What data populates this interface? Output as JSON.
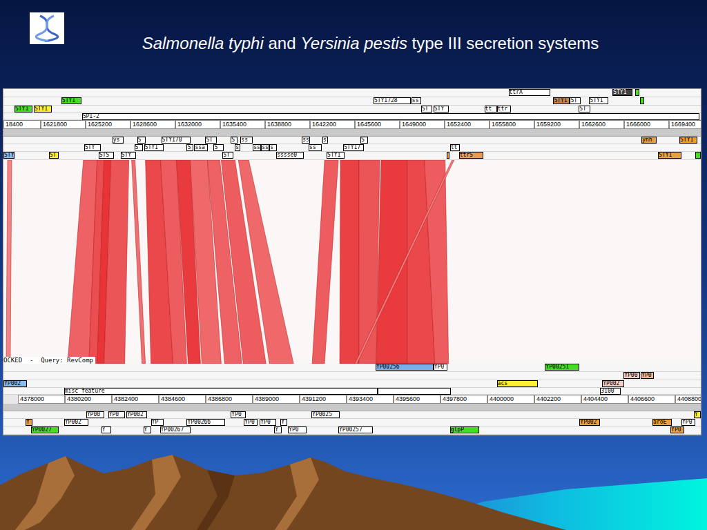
{
  "slide": {
    "title": [
      {
        "text": "Salmonella typhi",
        "italic": true
      },
      {
        "text": " and ",
        "italic": false
      },
      {
        "text": "Yersinia pestis",
        "italic": true
      },
      {
        "text": " type III secretion systems",
        "italic": false
      }
    ]
  },
  "query": {
    "view": {
      "start": 1618976,
      "end": 1671904
    },
    "ticks": [
      "18400",
      "1621800",
      "1625200",
      "1628600",
      "1632000",
      "1635400",
      "1638800",
      "1642200",
      "1645600",
      "1649000",
      "1652400",
      "1655800",
      "1659200",
      "1662600",
      "1666000",
      "1669400"
    ],
    "rows_above": [
      [
        {
          "label": "ttrA",
          "start": 1657312,
          "end": 1660502,
          "color": "#ffffff"
        },
        {
          "label": "STY1",
          "start": 1665209,
          "end": 1666726,
          "color": "#404040"
        },
        {
          "label": "",
          "start": 1666935,
          "end": 1667249,
          "color": "#44dd22"
        }
      ],
      [
        {
          "label": "STY1",
          "start": 1623369,
          "end": 1624886,
          "color": "#44dd22"
        },
        {
          "label": "STY1728",
          "start": 1647061,
          "end": 1649885,
          "color": "#ffffff"
        },
        {
          "label": "ss",
          "start": 1649937,
          "end": 1650670,
          "color": "#ffffff"
        },
        {
          "label": "STY1",
          "start": 1660711,
          "end": 1661967,
          "color": "#c8844c"
        },
        {
          "label": "ST",
          "start": 1661967,
          "end": 1662803,
          "color": "#ffffff"
        },
        {
          "label": "STY1",
          "start": 1663431,
          "end": 1664895,
          "color": "#ffffff"
        },
        {
          "label": "",
          "start": 1667301,
          "end": 1667615,
          "color": "#44dd22"
        }
      ],
      [
        {
          "label": "STY1",
          "start": 1619813,
          "end": 1621173,
          "color": "#44dd22"
        },
        {
          "label": "STY1",
          "start": 1621277,
          "end": 1622637,
          "color": "#ffee33"
        },
        {
          "label": "ST",
          "start": 1650670,
          "end": 1651507,
          "color": "#ffffff"
        },
        {
          "label": "STY",
          "start": 1651611,
          "end": 1652762,
          "color": "#ffffff"
        },
        {
          "label": "tt",
          "start": 1655481,
          "end": 1656423,
          "color": "#ffffff"
        },
        {
          "label": "ttr",
          "start": 1656423,
          "end": 1657469,
          "color": "#ffffff"
        },
        {
          "label": "ST",
          "start": 1662647,
          "end": 1663536,
          "color": "#ffffff"
        }
      ],
      [
        {
          "label": "SPI-2",
          "start": 1624938,
          "end": 1671799,
          "color": "#ffffff"
        }
      ]
    ],
    "rows_below": [
      [
        {
          "label": "ys",
          "start": 1627239,
          "end": 1628076,
          "color": "#ffffff"
        },
        {
          "label": "S",
          "start": 1629122,
          "end": 1629750,
          "color": "#ffffff"
        },
        {
          "label": "STY170",
          "start": 1630953,
          "end": 1633202,
          "color": "#ffffff"
        },
        {
          "label": "ST",
          "start": 1634300,
          "end": 1635189,
          "color": "#ffffff"
        },
        {
          "label": "S",
          "start": 1636235,
          "end": 1636758,
          "color": "#ffffff"
        },
        {
          "label": "ss",
          "start": 1636967,
          "end": 1637909,
          "color": "#ffffff"
        },
        {
          "label": "ss",
          "start": 1641622,
          "end": 1642197,
          "color": "#ffffff"
        },
        {
          "label": "s",
          "start": 1643191,
          "end": 1643609,
          "color": "#ffffff"
        },
        {
          "label": "S",
          "start": 1646067,
          "end": 1646643,
          "color": "#ffffff"
        },
        {
          "label": "ynh",
          "start": 1667406,
          "end": 1668556,
          "color": "#e8a040"
        },
        {
          "label": "STY1",
          "start": 1670282,
          "end": 1671642,
          "color": "#f0a020"
        }
      ],
      [
        {
          "label": "STY",
          "start": 1625095,
          "end": 1626350,
          "color": "#ffffff"
        },
        {
          "label": "S",
          "start": 1628913,
          "end": 1629541,
          "color": "#ffffff"
        },
        {
          "label": "STY1",
          "start": 1629645,
          "end": 1631110,
          "color": "#ffffff"
        },
        {
          "label": "S",
          "start": 1632888,
          "end": 1633411,
          "color": "#ffffff"
        },
        {
          "label": "ssa",
          "start": 1633463,
          "end": 1634509,
          "color": "#ffffff"
        },
        {
          "label": "S",
          "start": 1634928,
          "end": 1635712,
          "color": "#ffffff"
        },
        {
          "label": "s",
          "start": 1636549,
          "end": 1636967,
          "color": "#ffffff"
        },
        {
          "label": "ss",
          "start": 1637909,
          "end": 1638536,
          "color": "#ffffff"
        },
        {
          "label": "ss",
          "start": 1638536,
          "end": 1639164,
          "color": "#ffffff"
        },
        {
          "label": "s",
          "start": 1639164,
          "end": 1639739,
          "color": "#ffffff"
        },
        {
          "label": "ss",
          "start": 1642145,
          "end": 1643139,
          "color": "#ffffff"
        },
        {
          "label": "STY17",
          "start": 1644760,
          "end": 1646329,
          "color": "#ffffff"
        },
        {
          "label": "tt",
          "start": 1652866,
          "end": 1653599,
          "color": "#ffffff"
        }
      ],
      [
        {
          "label": "STY",
          "start": 1618976,
          "end": 1619708,
          "color": "#88bbee"
        },
        {
          "label": "ST",
          "start": 1622428,
          "end": 1623160,
          "color": "#ffee33"
        },
        {
          "label": "STS",
          "start": 1626193,
          "end": 1627344,
          "color": "#ffffff"
        },
        {
          "label": "STY",
          "start": 1627867,
          "end": 1629018,
          "color": "#ffffff"
        },
        {
          "label": "ST",
          "start": 1635607,
          "end": 1636444,
          "color": "#ffffff"
        },
        {
          "label": "sssse0",
          "start": 1639687,
          "end": 1641779,
          "color": "#ffffff"
        },
        {
          "label": "STY1",
          "start": 1643505,
          "end": 1644865,
          "color": "#ffffff"
        },
        {
          "label": "",
          "start": 1652605,
          "end": 1652814,
          "color": "#f0a020"
        },
        {
          "label": "ttrS",
          "start": 1653546,
          "end": 1655377,
          "color": "#e89a58"
        },
        {
          "label": "STY1",
          "start": 1668661,
          "end": 1670439,
          "color": "#e8a040"
        },
        {
          "label": "",
          "start": 1671485,
          "end": 1671904,
          "color": "#44dd22"
        }
      ]
    ]
  },
  "subject": {
    "view": {
      "start": 4377321,
      "end": 4410059
    },
    "ticks": [
      "4378000",
      "4380200",
      "4382400",
      "4384600",
      "4386800",
      "4389000",
      "4391200",
      "4393400",
      "4395600",
      "4397800",
      "4400000",
      "4402200",
      "4404400",
      "4406600",
      "4408800"
    ],
    "rows_above": [
      [
        {
          "label": "YP00256",
          "start": 4394790,
          "end": 4397507,
          "color": "#7ab0e8"
        },
        {
          "label": "YP0",
          "start": 4397507,
          "end": 4398154,
          "color": "#ffffff"
        },
        {
          "label": "YP00251",
          "start": 4402748,
          "end": 4404365,
          "color": "#44dd22"
        }
      ],
      [
        {
          "label": "YP00",
          "start": 4406436,
          "end": 4407212,
          "color": "#f4d0c8"
        },
        {
          "label": "YP0",
          "start": 4407244,
          "end": 4407859,
          "color": "#f0b890"
        }
      ],
      [
        {
          "label": "YP002",
          "start": 4377321,
          "end": 4378421,
          "color": "#88bbee"
        },
        {
          "label": "acs",
          "start": 4400483,
          "end": 4402424,
          "color": "#ffee33"
        },
        {
          "label": "YP002",
          "start": 4405433,
          "end": 4406468,
          "color": "#f4d0c8"
        }
      ],
      [
        {
          "label": "misc feature",
          "start": 4380167,
          "end": 4394887,
          "color": "#ffffff"
        },
        {
          "label": "",
          "start": 4394887,
          "end": 4398316,
          "color": "#ffffff"
        },
        {
          "label": "3100",
          "start": 4405336,
          "end": 4406306,
          "color": "#ffffff"
        }
      ]
    ],
    "rows_below": [
      [
        {
          "label": "YP00",
          "start": 4381203,
          "end": 4382044,
          "color": "#ffffff"
        },
        {
          "label": "YP0",
          "start": 4382238,
          "end": 4383014,
          "color": "#ffffff"
        },
        {
          "label": "YP002",
          "start": 4383079,
          "end": 4384049,
          "color": "#ffffff"
        },
        {
          "label": "YP0",
          "start": 4387996,
          "end": 4388708,
          "color": "#ffffff"
        },
        {
          "label": "YP0025",
          "start": 4391781,
          "end": 4393107,
          "color": "#ffffff"
        },
        {
          "label": "Y",
          "start": 4409735,
          "end": 4410059,
          "color": "#ffee33"
        }
      ],
      [
        {
          "label": "Y",
          "start": 4378356,
          "end": 4378679,
          "color": "#e8a040"
        },
        {
          "label": "YP002",
          "start": 4380167,
          "end": 4381300,
          "color": "#ffffff"
        },
        {
          "label": "YP",
          "start": 4384244,
          "end": 4384826,
          "color": "#ffffff"
        },
        {
          "label": "YP00266",
          "start": 4385926,
          "end": 4387737,
          "color": "#ffffff"
        },
        {
          "label": "YP0",
          "start": 4388611,
          "end": 4389258,
          "color": "#ffffff"
        },
        {
          "label": "YP0",
          "start": 4389355,
          "end": 4390131,
          "color": "#ffffff"
        },
        {
          "label": "Y",
          "start": 4390325,
          "end": 4390649,
          "color": "#ffffff"
        },
        {
          "label": "YP002",
          "start": 4404365,
          "end": 4405336,
          "color": "#e8a040"
        },
        {
          "label": "aroE",
          "start": 4407794,
          "end": 4408700,
          "color": "#e8a040"
        },
        {
          "label": "YP0",
          "start": 4409153,
          "end": 4409800,
          "color": "#ffffff"
        }
      ],
      [
        {
          "label": "YP0027",
          "start": 4378615,
          "end": 4379909,
          "color": "#44dd22"
        },
        {
          "label": "Y",
          "start": 4381914,
          "end": 4382367,
          "color": "#ffffff"
        },
        {
          "label": "Y",
          "start": 4383888,
          "end": 4384244,
          "color": "#ffffff"
        },
        {
          "label": "YP00267",
          "start": 4384664,
          "end": 4386120,
          "color": "#ffffff"
        },
        {
          "label": "Y",
          "start": 4390034,
          "end": 4390390,
          "color": "#ffffff"
        },
        {
          "label": "YP0",
          "start": 4390681,
          "end": 4391555,
          "color": "#ffffff"
        },
        {
          "label": "YP00257",
          "start": 4393043,
          "end": 4394660,
          "color": "#ffffff"
        },
        {
          "label": "glpP",
          "start": 4398283,
          "end": 4399642,
          "color": "#44dd22"
        },
        {
          "label": "YP0",
          "start": 4408635,
          "end": 4409282,
          "color": "#e8a040"
        }
      ]
    ]
  },
  "comparison": {
    "label": "OCKED  -  Query: RevComp",
    "matches": [
      {
        "top": [
          1619290,
          1619604
        ],
        "bottom": [
          4377450,
          4377644
        ],
        "identity": 0.3
      },
      {
        "top": [
          1625043,
          1626089
        ],
        "bottom": [
          4380329,
          4381332
        ],
        "identity": 0.55
      },
      {
        "top": [
          1626089,
          1626612
        ],
        "bottom": [
          4381332,
          4381720
        ],
        "identity": 0.7
      },
      {
        "top": [
          1626612,
          1627135
        ],
        "bottom": [
          4381720,
          4382044
        ],
        "identity": 0.9
      },
      {
        "top": [
          1627135,
          1628495
        ],
        "bottom": [
          4382044,
          4383014
        ],
        "identity": 0.65
      },
      {
        "top": [
          1628704,
          1628965
        ],
        "bottom": [
          4383823,
          4383985
        ],
        "identity": 0.45
      },
      {
        "top": [
          1629750,
          1630900
        ],
        "bottom": [
          4384244,
          4385279
        ],
        "identity": 0.75
      },
      {
        "top": [
          1630900,
          1632103
        ],
        "bottom": [
          4385279,
          4385926
        ],
        "identity": 0.6
      },
      {
        "top": [
          1632103,
          1633149
        ],
        "bottom": [
          4385990,
          4386573
        ],
        "identity": 0.85
      },
      {
        "top": [
          1633149,
          1634457
        ],
        "bottom": [
          4386637,
          4387543
        ],
        "identity": 0.5
      },
      {
        "top": [
          1634457,
          1635398
        ],
        "bottom": [
          4387705,
          4388514
        ],
        "identity": 0.55
      },
      {
        "top": [
          1635503,
          1636549
        ],
        "bottom": [
          4388578,
          4389646
        ],
        "identity": 0.6
      },
      {
        "top": [
          1636810,
          1637594
        ],
        "bottom": [
          4389808,
          4390940
        ],
        "identity": 0.5
      },
      {
        "top": [
          1643348,
          1644394
        ],
        "bottom": [
          4391813,
          4392396
        ],
        "identity": 0.6
      },
      {
        "top": [
          1644551,
          1645963
        ],
        "bottom": [
          4393107,
          4394013
        ],
        "identity": 0.8
      },
      {
        "top": [
          1645963,
          1647532
        ],
        "bottom": [
          4394013,
          4394822
        ],
        "identity": 0.65
      },
      {
        "top": [
          1647636,
          1649624
        ],
        "bottom": [
          4394822,
          4396278
        ],
        "identity": 0.85
      },
      {
        "top": [
          1649624,
          1650931
        ],
        "bottom": [
          4396278,
          4397572
        ],
        "identity": 0.75
      },
      {
        "top": [
          1650931,
          1652500
        ],
        "bottom": [
          4397572,
          4398219
        ],
        "identity": 0.6
      },
      {
        "top": [
          1653023,
          1653180
        ],
        "bottom": [
          4393819,
          4393916
        ],
        "identity": 0.35
      }
    ]
  }
}
